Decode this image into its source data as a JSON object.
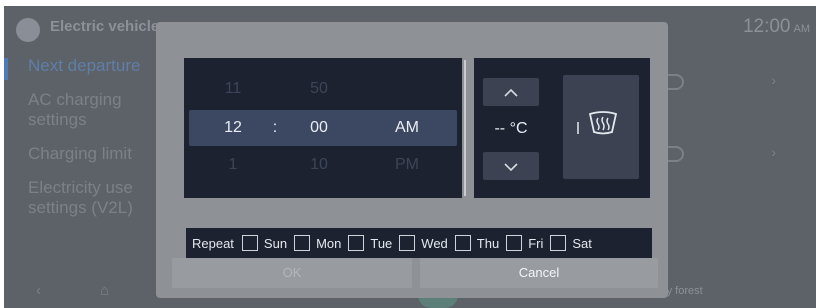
{
  "app": {
    "title": "Electric vehicle",
    "clock_time": "12:00",
    "clock_ampm": "AM"
  },
  "sidebar": {
    "items": [
      {
        "label": "Next departure",
        "active": true
      },
      {
        "label": "AC charging settings"
      },
      {
        "label": "Charging limit"
      },
      {
        "label": "Electricity use settings (V2L)"
      }
    ]
  },
  "bottom_bar": {
    "media_text": "Lively forest"
  },
  "dialog": {
    "time_picker": {
      "hour": {
        "prev": "11",
        "selected": "12",
        "next": "1"
      },
      "separator": ":",
      "minute": {
        "prev": "50",
        "selected": "00",
        "next": "10"
      },
      "ampm": {
        "prev": "",
        "selected": "AM",
        "next": "PM"
      }
    },
    "temperature": {
      "value": "-- °C",
      "up_icon": "chevron-up-icon",
      "down_icon": "chevron-down-icon",
      "defrost_icon": "rear-defrost-icon"
    },
    "repeat": {
      "label": "Repeat",
      "days": [
        {
          "label": "Sun",
          "checked": false
        },
        {
          "label": "Mon",
          "checked": false
        },
        {
          "label": "Tue",
          "checked": false
        },
        {
          "label": "Wed",
          "checked": false
        },
        {
          "label": "Thu",
          "checked": false
        },
        {
          "label": "Fri",
          "checked": false
        },
        {
          "label": "Sat",
          "checked": false
        }
      ]
    },
    "buttons": {
      "ok_label": "OK",
      "cancel_label": "Cancel"
    }
  },
  "colors": {
    "dialog_panel": "#1d2230",
    "selection": "#3c4862",
    "accent": "#4c7bb5"
  }
}
